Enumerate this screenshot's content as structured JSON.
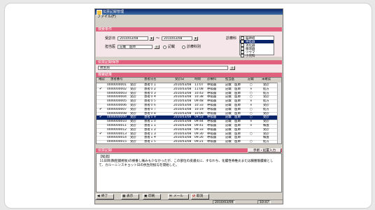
{
  "window": {
    "title": "伝票記録管理"
  },
  "menu": {
    "items": [
      "ファイル(F)"
    ]
  },
  "search": {
    "header": "検索条件",
    "date_label": "受診日",
    "date_from": "2010/03/08",
    "tilde": "〜",
    "date_to": "2010/03/08",
    "doctor_label": "担当医",
    "doctor_value": "記載　医師",
    "radio_1_label": "記載",
    "radio_2_label": "診療科別",
    "type_label": "診療科",
    "type_options": [
      {
        "label": "脳神経",
        "selected": false
      },
      {
        "label": "呼吸器",
        "selected": true
      },
      {
        "label": "消化器",
        "selected": false
      },
      {
        "label": "循環器",
        "selected": false
      },
      {
        "label": "ツウマ",
        "selected": false
      },
      {
        "label": "小児科",
        "selected": false
      }
    ]
  },
  "view": {
    "header": "伝票記録保存",
    "memo_value": "抗生剤"
  },
  "results": {
    "header": "検索結果",
    "columns": [
      "確認",
      "患者番号",
      "",
      "患者氏名",
      "受診日",
      "時間",
      "診療科",
      "担当医",
      "記載",
      "未確認"
    ],
    "rows": [
      {
        "check": "",
        "id": "0000000001",
        "ward": "受診",
        "name": "患者０１",
        "date": "2010/03/08",
        "time": "11:07",
        "dept": "呼吸器",
        "doctor": "記載　医師",
        "mark": "○",
        "status": "受診"
      },
      {
        "check": "✔",
        "id": "0000000002",
        "ward": "受診",
        "name": "患者０２",
        "date": "2010/03/08",
        "time": "11:08",
        "dept": "呼吸器",
        "doctor": "記載　医師",
        "mark": "×",
        "status": "処方"
      },
      {
        "check": "",
        "id": "0000000003",
        "ward": "受診",
        "name": "患者０３",
        "date": "2010/03/08",
        "time": "10:43",
        "dept": "呼吸器",
        "doctor": "記載　医師",
        "mark": "○",
        "status": "処方"
      },
      {
        "check": "",
        "id": "0000000004",
        "ward": "受診",
        "name": "患者０４",
        "date": "2010/03/08",
        "time": "10:38",
        "dept": "呼吸器",
        "doctor": "記載　医師",
        "mark": "○",
        "status": "受診"
      },
      {
        "check": "",
        "id": "0000000005",
        "ward": "受診",
        "name": "患者０５",
        "date": "2010/03/08",
        "time": "09:48",
        "dept": "呼吸器",
        "doctor": "記載　医師",
        "mark": "×",
        "status": "処方"
      },
      {
        "check": "",
        "id": "0000000006",
        "ward": "受診",
        "name": "患者０６",
        "date": "2010/03/08",
        "time": "10:33",
        "dept": "呼吸器",
        "doctor": "記載　医師",
        "mark": "×",
        "status": "受診"
      },
      {
        "check": "✔",
        "id": "0000000007",
        "ward": "受診",
        "name": "患者０７",
        "date": "2010/03/08",
        "time": "10:19",
        "dept": "呼吸器",
        "doctor": "記載　医師",
        "mark": "○",
        "status": "処方"
      },
      {
        "check": "",
        "id": "0000000008",
        "ward": "受診",
        "name": "患者０８",
        "date": "2010/03/08",
        "time": "10:06",
        "dept": "呼吸器",
        "doctor": "記載　医師",
        "mark": "○",
        "status": "受診"
      },
      {
        "check": "✔",
        "id": "0000000009",
        "ward": "受診",
        "name": "患者０９",
        "date": "2010/03/08",
        "time": "09:53",
        "dept": "呼吸器",
        "doctor": "記載　医師",
        "mark": "○",
        "status": "受診",
        "selected": true
      },
      {
        "check": "",
        "id": "0000000010",
        "ward": "受診",
        "name": "患者１０",
        "date": "2010/03/08",
        "time": "09:44",
        "dept": "呼吸器",
        "doctor": "記載　医師",
        "mark": "×",
        "status": "受診"
      },
      {
        "check": "",
        "id": "0000000011",
        "ward": "受診",
        "name": "患者１１",
        "date": "2010/03/08",
        "time": "09:41",
        "dept": "呼吸器",
        "doctor": "記載　医師",
        "mark": "×",
        "status": "検査"
      },
      {
        "check": "",
        "id": "0000000012",
        "ward": "受診",
        "name": "患者１２",
        "date": "2010/03/08",
        "time": "09:33",
        "dept": "呼吸器",
        "doctor": "記載　医師",
        "mark": "",
        "status": "受診"
      },
      {
        "check": "✔",
        "id": "0000000013",
        "ward": "受診",
        "name": "患者１３",
        "date": "2010/03/08",
        "time": "09:30",
        "dept": "呼吸器",
        "doctor": "記載　医師",
        "mark": "○",
        "status": "受診"
      },
      {
        "check": "",
        "id": "0000000014",
        "ward": "受診",
        "name": "患者１４",
        "date": "2010/03/08",
        "time": "09:26",
        "dept": "呼吸器",
        "doctor": "記載　医師",
        "mark": "",
        "status": "検査"
      },
      {
        "check": "",
        "id": "0000000015",
        "ward": "受診",
        "name": "患者１５",
        "date": "2010/03/08",
        "time": "09:21",
        "dept": "呼吸器",
        "doctor": "記載　医師",
        "mark": "○",
        "status": "処方"
      }
    ]
  },
  "record": {
    "header": "伝票記録",
    "header_right": "手術・処置入力",
    "text": "【経過】\n 11日目(胸腔鏡術後)の療養し痛みも少なかったが、この部位の皮膚炎に、すなわち、化膿性脊椎炎または腸腰筋膿瘍として、カルーニンスキョット日の抗生剤投与を開始した。"
  },
  "toolbar": {
    "buttons": [
      {
        "glyph": "◀",
        "label": "終了"
      },
      {
        "glyph": "▦",
        "label": "表示"
      },
      {
        "glyph": "▣",
        "label": "印刷"
      },
      {
        "glyph": "✉",
        "label": "メール"
      },
      {
        "glyph": "↺",
        "label": "取消"
      }
    ]
  },
  "status": {
    "date": "2010/03/09",
    "time": "10:47"
  },
  "colors": {
    "section_header": "#e0607e",
    "title_bar": "#0a246a",
    "panel_bg": "#f5e6ea"
  }
}
